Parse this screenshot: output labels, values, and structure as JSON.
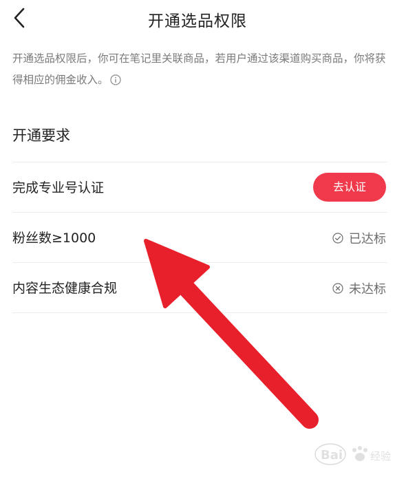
{
  "header": {
    "title": "开通选品权限"
  },
  "intro": {
    "text": "开通选品权限后，你可在笔记里关联商品，若用户通过该渠道购买商品，你将获得相应的佣金收入。"
  },
  "requirements": {
    "title": "开通要求",
    "items": [
      {
        "label": "完成专业号认证",
        "action": "去认证"
      },
      {
        "label": "粉丝数≥1000",
        "status": "已达标"
      },
      {
        "label": "内容生态健康合规",
        "status": "未达标"
      }
    ]
  },
  "colors": {
    "accent": "#f03a4c",
    "annotation_arrow": "#e8202c"
  },
  "watermark": {
    "icon": "baidu-paw-icon",
    "text": "Bai",
    "text2": "经验"
  }
}
